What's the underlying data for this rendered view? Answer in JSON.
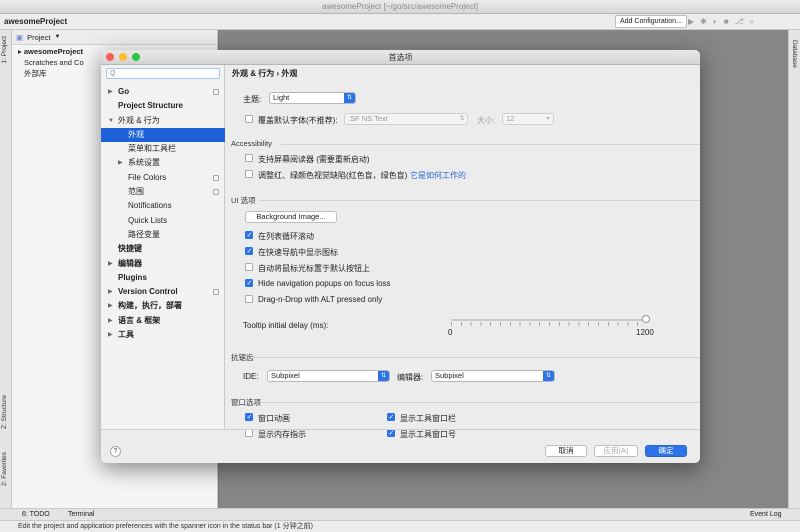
{
  "ide": {
    "window_title": "awesomeProject [~/go/src/awesomeProject]",
    "project_name": "awesomeProject",
    "add_configuration": "Add Configuration...",
    "project_dropdown": "Project",
    "tree": [
      {
        "label": "awesomeProject",
        "bold": true
      },
      {
        "label": "Scratches and Co",
        "bold": false
      },
      {
        "label": "外部库",
        "bold": false
      }
    ],
    "left_tabs": [
      "1: Project",
      "Z: Structure",
      "2: Favorites"
    ],
    "right_tab": "Database",
    "bottom_tabs": [
      "6: TODO",
      "Terminal"
    ],
    "event_log": "Event Log",
    "status": "Edit the project and application preferences with the spanner icon in the status bar (1 分钟之前)"
  },
  "dialog": {
    "title": "首选项",
    "search_placeholder": "Q",
    "breadcrumb": "外观 & 行为  ›  外观",
    "nav": [
      {
        "label": "Go",
        "arrow": "right",
        "bold": true,
        "indent": 0,
        "copy": true
      },
      {
        "label": "Project Structure",
        "arrow": "",
        "bold": true,
        "indent": 0,
        "copy": false
      },
      {
        "label": "外观 & 行为",
        "arrow": "down",
        "bold": false,
        "indent": 0,
        "copy": false
      },
      {
        "label": "外观",
        "arrow": "",
        "bold": false,
        "indent": 1,
        "copy": false,
        "selected": true
      },
      {
        "label": "菜单和工具栏",
        "arrow": "",
        "bold": false,
        "indent": 1,
        "copy": false
      },
      {
        "label": "系统设置",
        "arrow": "right",
        "bold": false,
        "indent": 1,
        "copy": false
      },
      {
        "label": "File Colors",
        "arrow": "",
        "bold": false,
        "indent": 1,
        "copy": true
      },
      {
        "label": "范围",
        "arrow": "",
        "bold": false,
        "indent": 1,
        "copy": true
      },
      {
        "label": "Notifications",
        "arrow": "",
        "bold": false,
        "indent": 1,
        "copy": false
      },
      {
        "label": "Quick Lists",
        "arrow": "",
        "bold": false,
        "indent": 1,
        "copy": false
      },
      {
        "label": "路径变量",
        "arrow": "",
        "bold": false,
        "indent": 1,
        "copy": false
      },
      {
        "label": "快捷键",
        "arrow": "",
        "bold": true,
        "indent": 0,
        "copy": false
      },
      {
        "label": "编辑器",
        "arrow": "right",
        "bold": true,
        "indent": 0,
        "copy": false
      },
      {
        "label": "Plugins",
        "arrow": "",
        "bold": true,
        "indent": 0,
        "copy": false
      },
      {
        "label": "Version Control",
        "arrow": "right",
        "bold": true,
        "indent": 0,
        "copy": true
      },
      {
        "label": "构建，执行，部署",
        "arrow": "right",
        "bold": true,
        "indent": 0,
        "copy": false
      },
      {
        "label": "语言 & 框架",
        "arrow": "right",
        "bold": true,
        "indent": 0,
        "copy": false
      },
      {
        "label": "工具",
        "arrow": "right",
        "bold": true,
        "indent": 0,
        "copy": false
      }
    ],
    "theme_label": "主题:",
    "theme_value": "Light",
    "override_font_label": "覆盖默认字体(不推荐):",
    "override_font_checked": false,
    "font_value": ".SF NS Text",
    "size_label": "大小:",
    "size_value": "12",
    "accessibility": {
      "title": "Accessibility",
      "screen_reader": "支持屏幕阅读器 (需要重新启动)",
      "color_blind": "调整红、绿颜色视觉缺陷(红色盲，绿色盲)",
      "color_blind_link": "它是如何工作的"
    },
    "ui_options": {
      "title": "UI 选项",
      "background_image": "Background Image...",
      "checkboxes": [
        {
          "label": "在列表循环滚动",
          "checked": true
        },
        {
          "label": "在快速导航中显示图标",
          "checked": true
        },
        {
          "label": "自动将鼠标光标置于默认按钮上",
          "checked": false
        },
        {
          "label": "Hide navigation popups on focus loss",
          "checked": true
        },
        {
          "label": "Drag-n-Drop with ALT pressed only",
          "checked": false
        }
      ],
      "tooltip_label": "Tooltip initial delay (ms):",
      "tooltip_min": "0",
      "tooltip_max": "1200",
      "tooltip_value": 1200
    },
    "antialiasing": {
      "title": "抗锯齿",
      "ide_label": "IDE:",
      "ide_value": "Subpixel",
      "editor_label": "编辑器:",
      "editor_value": "Subpixel"
    },
    "window_options": {
      "title": "窗口选项",
      "items": [
        {
          "label": "窗口动画",
          "checked": true
        },
        {
          "label": "显示工具窗口栏",
          "checked": true
        },
        {
          "label": "显示内存指示",
          "checked": false
        },
        {
          "label": "显示工具窗口号",
          "checked": true
        }
      ]
    },
    "buttons": {
      "help": "?",
      "cancel": "取消",
      "apply": "应用(A)",
      "ok": "确定"
    }
  },
  "colors": {
    "accent": "#2d72e8",
    "selection": "#1e61d9"
  }
}
